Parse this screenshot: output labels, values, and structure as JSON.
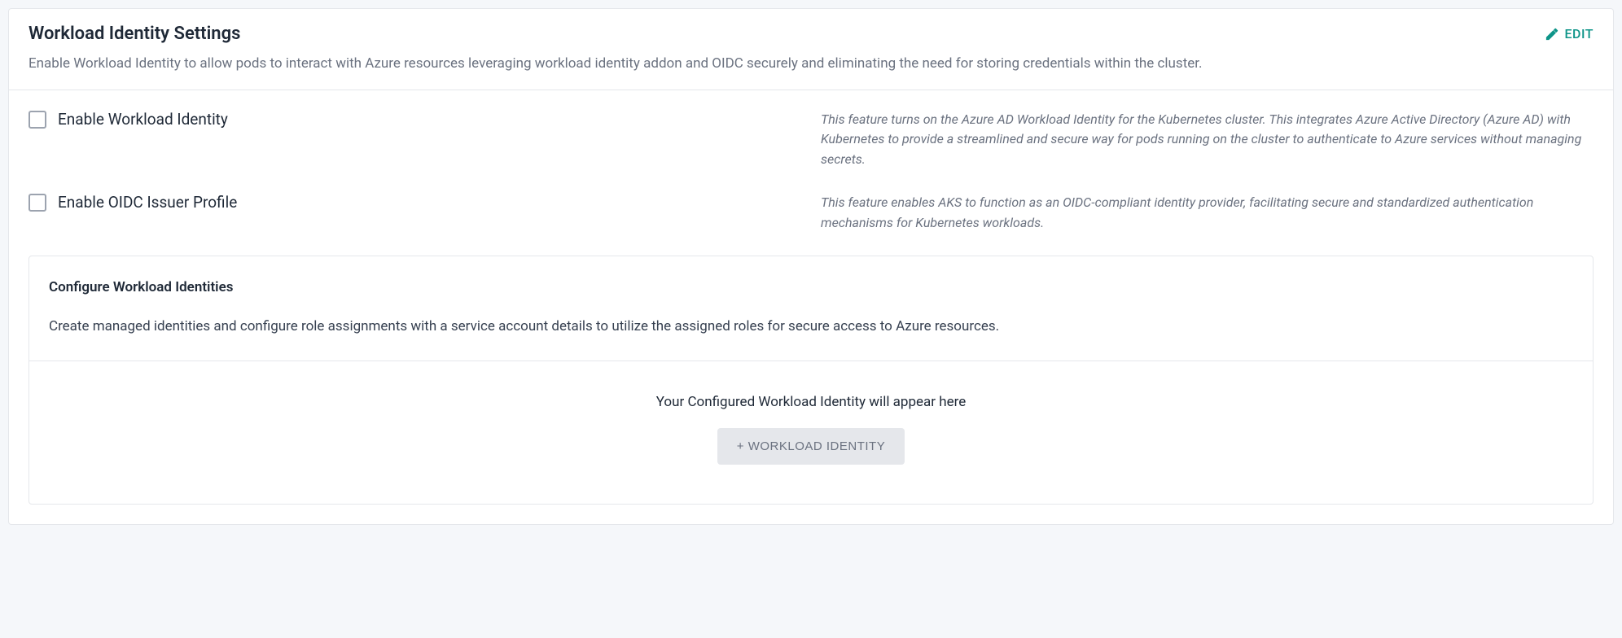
{
  "header": {
    "title": "Workload Identity Settings",
    "edit_label": "EDIT",
    "description": "Enable Workload Identity to allow pods to interact with Azure resources leveraging workload identity addon and OIDC securely and eliminating the need for storing credentials within the cluster."
  },
  "settings": [
    {
      "label": "Enable Workload Identity",
      "help": "This feature turns on the Azure AD Workload Identity for the Kubernetes cluster. This integrates Azure Active Directory (Azure AD) with Kubernetes to provide a streamlined and secure way for pods running on the cluster to authenticate to Azure services without managing secrets."
    },
    {
      "label": "Enable OIDC Issuer Profile",
      "help": "This feature enables AKS to function as an OIDC-compliant identity provider, facilitating secure and standardized authentication mechanisms for Kubernetes workloads."
    }
  ],
  "configure": {
    "title": "Configure Workload Identities",
    "description": "Create managed identities and configure role assignments with a service account details to utilize the assigned roles for secure access to Azure resources.",
    "empty_text": "Your Configured Workload Identity will appear here",
    "add_button_label": "+ WORKLOAD IDENTITY"
  }
}
